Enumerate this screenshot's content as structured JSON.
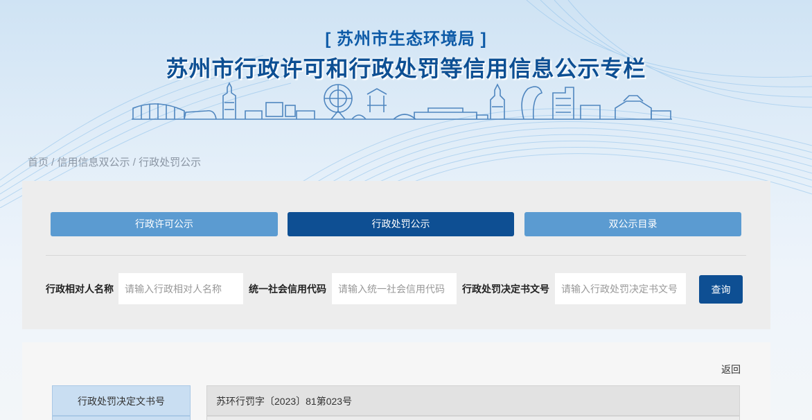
{
  "header": {
    "subtitle": "[ 苏州市生态环境局 ]",
    "title": "苏州市行政许可和行政处罚等信用信息公示专栏"
  },
  "breadcrumb": {
    "home": "首页",
    "separator": " / ",
    "level2": "信用信息双公示",
    "current": "行政处罚公示"
  },
  "tabs": [
    {
      "label": "行政许可公示",
      "active": false
    },
    {
      "label": "行政处罚公示",
      "active": true
    },
    {
      "label": "双公示目录",
      "active": false
    }
  ],
  "search": {
    "name_label": "行政相对人名称",
    "name_placeholder": "请输入行政相对人名称",
    "credit_label": "统一社会信用代码",
    "credit_placeholder": "请输入统一社会信用代码",
    "doc_label": "行政处罚决定书文号",
    "doc_placeholder": "请输入行政处罚决定书文号",
    "button": "查询"
  },
  "detail": {
    "back": "返回",
    "rows": [
      {
        "label": "行政处罚决定文书号",
        "value": "苏环行罚字〔2023〕81第023号"
      }
    ]
  },
  "colors": {
    "primary": "#0e4f93",
    "tab_light": "#5b9bd1",
    "title": "#0d4f93",
    "label_cell": "#c9def2"
  }
}
